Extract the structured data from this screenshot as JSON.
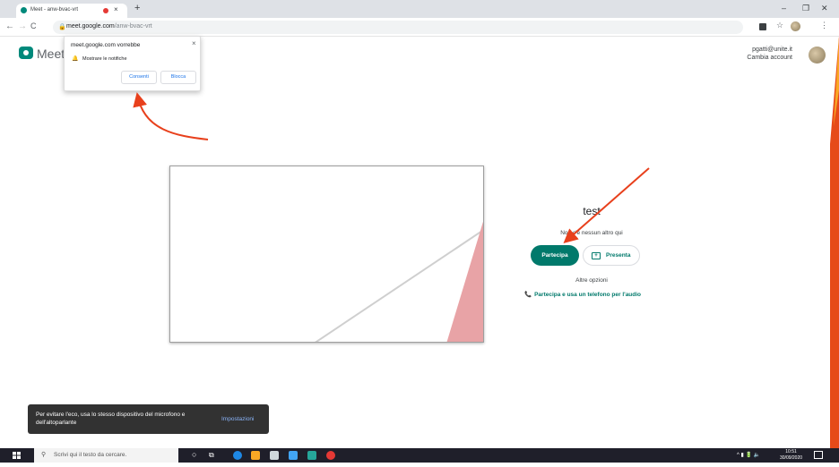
{
  "browser": {
    "tab_title": "Meet - anw-bvac-vrt",
    "tab_close": "×",
    "new_tab": "+",
    "window_controls": {
      "minimize": "–",
      "maximize": "❐",
      "close": "✕"
    },
    "nav": {
      "back": "←",
      "forward": "→",
      "reload": "C"
    },
    "url_host": "meet.google.com",
    "url_path": "/anw-bvac-vrt",
    "toolbar_icons": [
      "record-icon",
      "star-icon",
      "extension-icon",
      "menu-icon"
    ]
  },
  "meet": {
    "brand": "Meet",
    "account_email": "pgatti@unite.it",
    "switch_account": "Cambia account"
  },
  "notification_popup": {
    "title": "meet.google.com vorrebbe",
    "message": "Mostrare le notifiche",
    "allow": "Consenti",
    "block": "Blocca",
    "close": "×"
  },
  "join_panel": {
    "meeting_name": "test",
    "status": "Non c'è nessun altro qui",
    "join_button": "Partecipa",
    "present_button": "Presenta",
    "more_options": "Altre opzioni",
    "phone_join": "Partecipa e usa un telefono per l'audio"
  },
  "snackbar": {
    "text": "Per evitare l'eco, usa lo stesso dispositivo del microfono e dell'altoparlante",
    "action": "Impostazioni"
  },
  "taskbar": {
    "search_placeholder": "Scrivi qui il testo da cercare.",
    "time": "10:51",
    "date": "30/09/2020"
  },
  "colors": {
    "accent": "#00796b",
    "annotation_arrow": "#e8401c"
  }
}
